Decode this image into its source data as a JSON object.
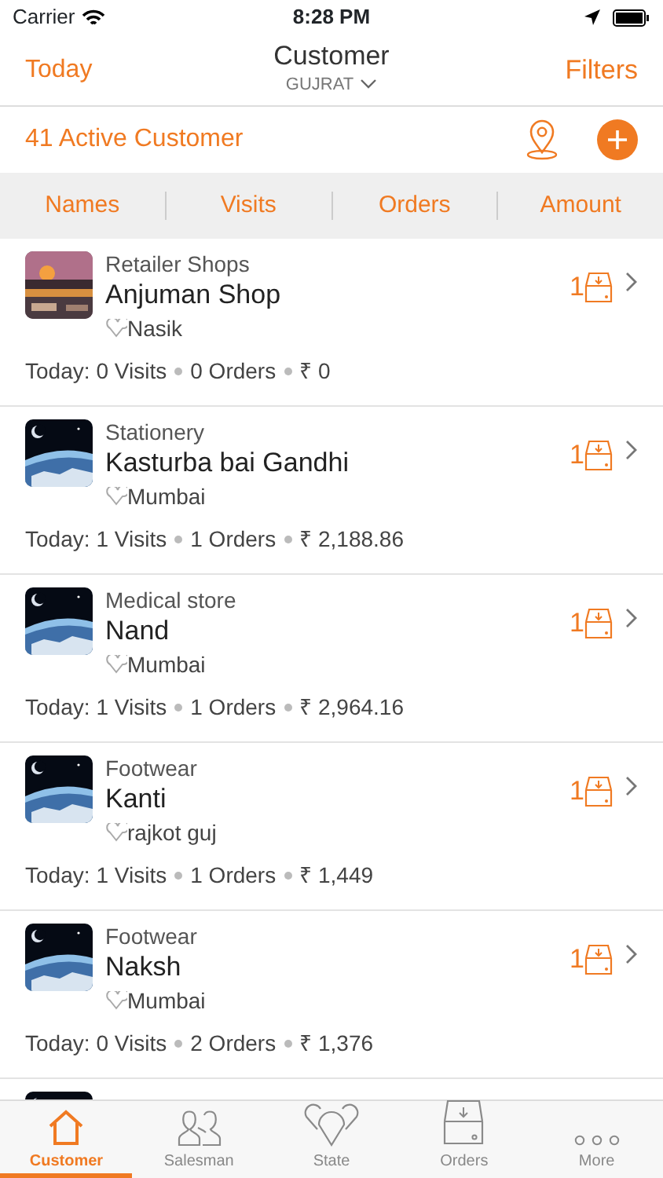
{
  "status_bar": {
    "carrier": "Carrier",
    "time": "8:28 PM"
  },
  "nav": {
    "left": "Today",
    "title": "Customer",
    "subtitle": "GUJRAT",
    "right": "Filters"
  },
  "summary": {
    "count_label": "41 Active Customer"
  },
  "sort_headers": [
    "Names",
    "Visits",
    "Orders",
    "Amount"
  ],
  "customers": [
    {
      "category": "Retailer Shops",
      "name": "Anjuman Shop",
      "city": "Nasik",
      "pending": "1",
      "today": "Today:",
      "visits": "0 Visits",
      "orders": "0 Orders",
      "amount": "₹ 0"
    },
    {
      "category": "Stationery",
      "name": "Kasturba bai Gandhi",
      "city": "Mumbai",
      "pending": "1",
      "today": "Today:",
      "visits": "1 Visits",
      "orders": "1 Orders",
      "amount": "₹ 2,188.86"
    },
    {
      "category": "Medical store",
      "name": "Nand",
      "city": "Mumbai",
      "pending": "1",
      "today": "Today:",
      "visits": "1 Visits",
      "orders": "1 Orders",
      "amount": "₹ 2,964.16"
    },
    {
      "category": "Footwear",
      "name": "Kanti",
      "city": "rajkot guj",
      "pending": "1",
      "today": "Today:",
      "visits": "1 Visits",
      "orders": "1 Orders",
      "amount": "₹ 1,449"
    },
    {
      "category": "Footwear",
      "name": "Naksh",
      "city": "Mumbai",
      "pending": "1",
      "today": "Today:",
      "visits": "0 Visits",
      "orders": "2 Orders",
      "amount": "₹ 1,376"
    },
    {
      "kind": "picture"
    }
  ],
  "tabs": [
    {
      "label": "Customer",
      "selected": true
    },
    {
      "label": "Salesman",
      "selected": false
    },
    {
      "label": "State",
      "selected": false
    },
    {
      "label": "Orders",
      "selected": false
    },
    {
      "label": "More",
      "selected": false
    }
  ]
}
